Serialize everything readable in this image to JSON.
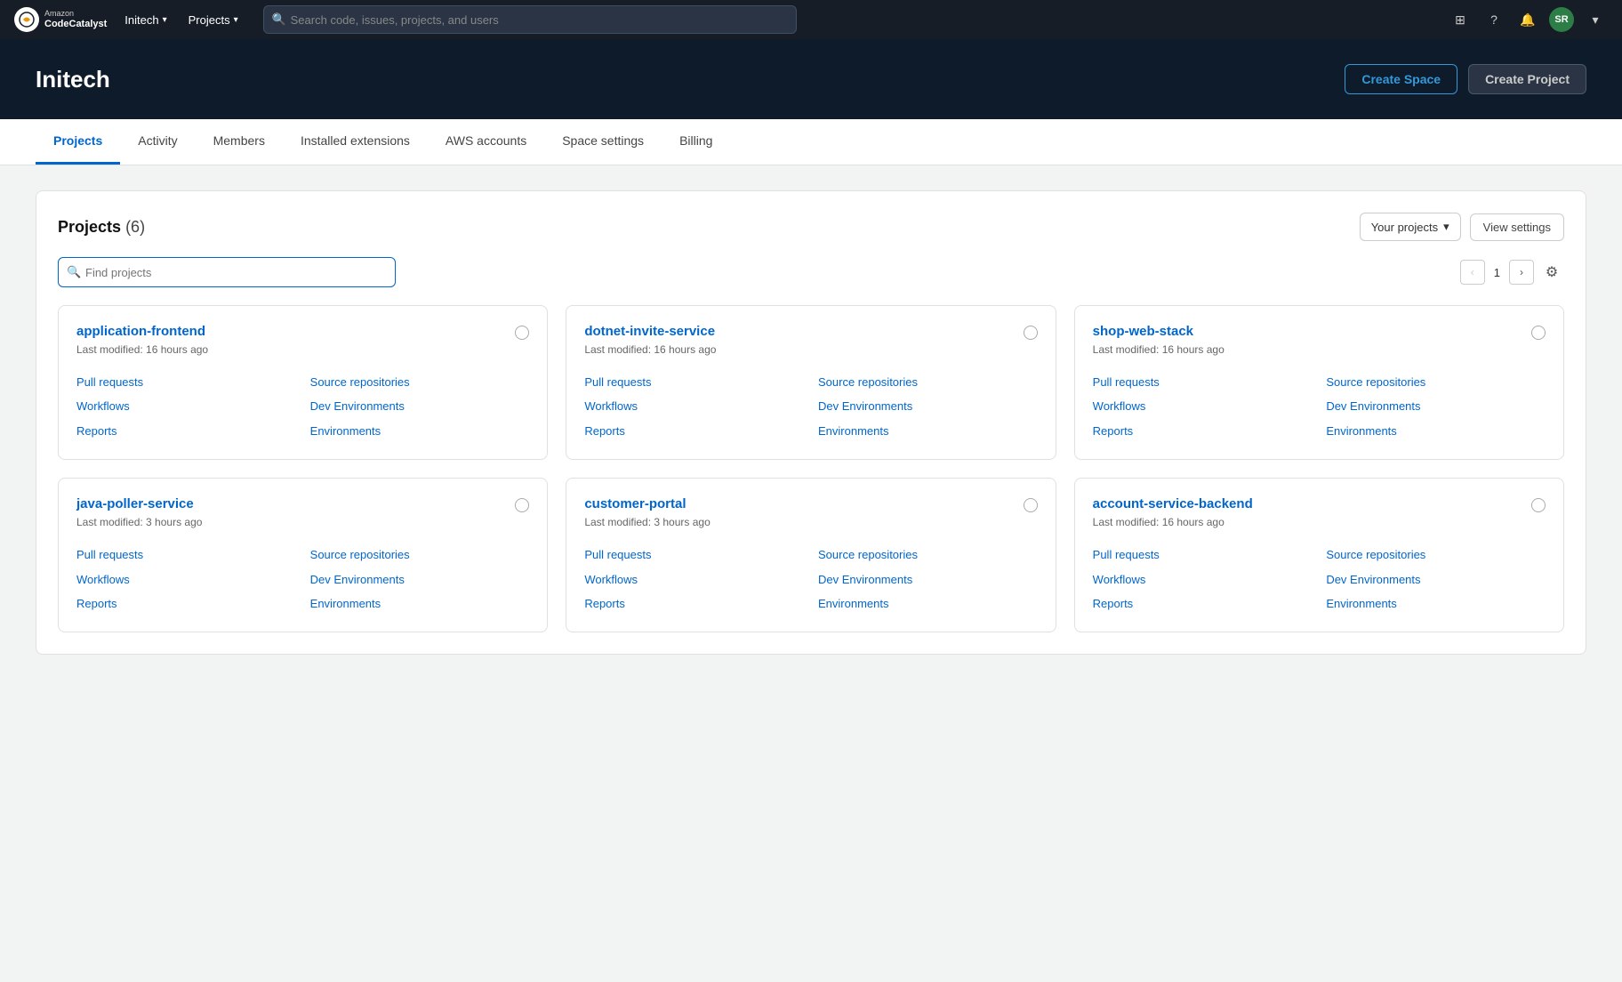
{
  "topNav": {
    "logo": {
      "amazon": "Amazon",
      "codecatalyst": "CodeCatalyst"
    },
    "initech": "Initech",
    "initechChevron": "▾",
    "projects": "Projects",
    "projectsChevron": "▾",
    "searchPlaceholder": "Search code, issues, projects, and users",
    "avatarInitials": "SR",
    "avatarChevron": "▾"
  },
  "heroHeader": {
    "title": "Initech",
    "createSpaceLabel": "Create Space",
    "createProjectLabel": "Create Project"
  },
  "tabs": [
    {
      "id": "projects",
      "label": "Projects",
      "active": true
    },
    {
      "id": "activity",
      "label": "Activity",
      "active": false
    },
    {
      "id": "members",
      "label": "Members",
      "active": false
    },
    {
      "id": "installed-extensions",
      "label": "Installed extensions",
      "active": false
    },
    {
      "id": "aws-accounts",
      "label": "AWS accounts",
      "active": false
    },
    {
      "id": "space-settings",
      "label": "Space settings",
      "active": false
    },
    {
      "id": "billing",
      "label": "Billing",
      "active": false
    }
  ],
  "projectsPanel": {
    "title": "Projects",
    "count": "(6)",
    "filterLabel": "Your projects",
    "filterChevron": "▾",
    "viewSettingsLabel": "View settings",
    "searchPlaceholder": "Find projects",
    "pagination": {
      "currentPage": "1",
      "prevDisabled": true,
      "nextDisabled": false
    },
    "projects": [
      {
        "id": "application-frontend",
        "name": "application-frontend",
        "modified": "Last modified: 16 hours ago",
        "links": [
          {
            "id": "pr",
            "label": "Pull requests"
          },
          {
            "id": "src",
            "label": "Source repositories"
          },
          {
            "id": "wf",
            "label": "Workflows"
          },
          {
            "id": "de",
            "label": "Dev Environments"
          },
          {
            "id": "rep",
            "label": "Reports"
          },
          {
            "id": "env",
            "label": "Environments"
          }
        ]
      },
      {
        "id": "dotnet-invite-service",
        "name": "dotnet-invite-service",
        "modified": "Last modified: 16 hours ago",
        "links": [
          {
            "id": "pr",
            "label": "Pull requests"
          },
          {
            "id": "src",
            "label": "Source repositories"
          },
          {
            "id": "wf",
            "label": "Workflows"
          },
          {
            "id": "de",
            "label": "Dev Environments"
          },
          {
            "id": "rep",
            "label": "Reports"
          },
          {
            "id": "env",
            "label": "Environments"
          }
        ]
      },
      {
        "id": "shop-web-stack",
        "name": "shop-web-stack",
        "modified": "Last modified: 16 hours ago",
        "links": [
          {
            "id": "pr",
            "label": "Pull requests"
          },
          {
            "id": "src",
            "label": "Source repositories"
          },
          {
            "id": "wf",
            "label": "Workflows"
          },
          {
            "id": "de",
            "label": "Dev Environments"
          },
          {
            "id": "rep",
            "label": "Reports"
          },
          {
            "id": "env",
            "label": "Environments"
          }
        ]
      },
      {
        "id": "java-poller-service",
        "name": "java-poller-service",
        "modified": "Last modified: 3 hours ago",
        "links": [
          {
            "id": "pr",
            "label": "Pull requests"
          },
          {
            "id": "src",
            "label": "Source repositories"
          },
          {
            "id": "wf",
            "label": "Workflows"
          },
          {
            "id": "de",
            "label": "Dev Environments"
          },
          {
            "id": "rep",
            "label": "Reports"
          },
          {
            "id": "env",
            "label": "Environments"
          }
        ]
      },
      {
        "id": "customer-portal",
        "name": "customer-portal",
        "modified": "Last modified: 3 hours ago",
        "links": [
          {
            "id": "pr",
            "label": "Pull requests"
          },
          {
            "id": "src",
            "label": "Source repositories"
          },
          {
            "id": "wf",
            "label": "Workflows"
          },
          {
            "id": "de",
            "label": "Dev Environments"
          },
          {
            "id": "rep",
            "label": "Reports"
          },
          {
            "id": "env",
            "label": "Environments"
          }
        ]
      },
      {
        "id": "account-service-backend",
        "name": "account-service-backend",
        "modified": "Last modified: 16 hours ago",
        "links": [
          {
            "id": "pr",
            "label": "Pull requests"
          },
          {
            "id": "src",
            "label": "Source repositories"
          },
          {
            "id": "wf",
            "label": "Workflows"
          },
          {
            "id": "de",
            "label": "Dev Environments"
          },
          {
            "id": "rep",
            "label": "Reports"
          },
          {
            "id": "env",
            "label": "Environments"
          }
        ]
      }
    ]
  }
}
